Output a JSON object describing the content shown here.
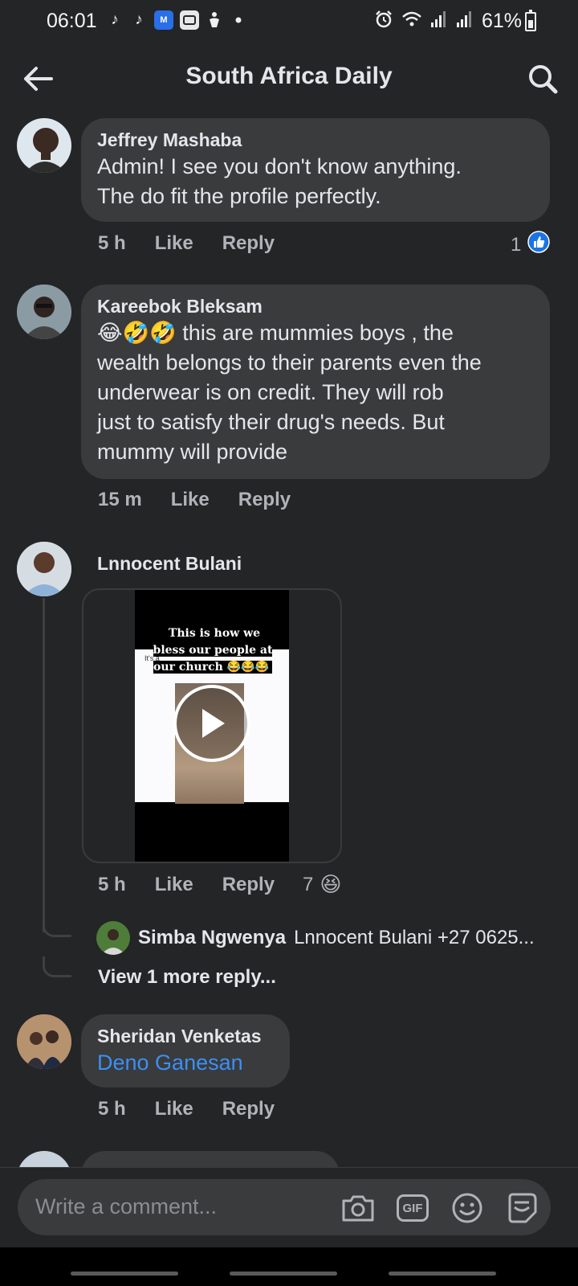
{
  "status_bar": {
    "time": "06:01",
    "battery": "61%",
    "tiktok_glyph": "♪",
    "app_badge": "M"
  },
  "header": {
    "title": "South Africa Daily"
  },
  "comments": [
    {
      "author": "Jeffrey Mashaba",
      "text_lines": [
        "Admin! I see you don't know anything.",
        "The do fit the profile perfectly."
      ],
      "time": "5 h",
      "like": "Like",
      "reply": "Reply",
      "reactions": "1"
    },
    {
      "author": "Kareebok Bleksam",
      "emoji": "😂🤣🤣",
      "text_lines": [
        " this are mummies boys , the",
        "wealth belongs to their parents even the",
        "underwear  is on credit.  They will rob",
        "just to satisfy their drug's needs.  But",
        "mummy will provide"
      ],
      "time": "15 m",
      "like": "Like",
      "reply": "Reply"
    },
    {
      "author": "Lnnocent Bulani",
      "video_caption": "This is how we bless our people at our church 😂😂😂",
      "video_side_text": "It's a",
      "time": "5 h",
      "like": "Like",
      "reply": "Reply",
      "reactions": "7",
      "reaction_emoji": "😆"
    },
    {
      "author": "Sheridan Venketas",
      "mention": "Deno Ganesan",
      "time": "5 h",
      "like": "Like",
      "reply": "Reply"
    }
  ],
  "nested_reply": {
    "author": "Simba Ngwenya",
    "text": "Lnnocent Bulani +27 0625..."
  },
  "view_more": "View 1 more reply...",
  "composer": {
    "placeholder": "Write a comment...",
    "gif_label": "GIF"
  },
  "colors": {
    "background": "#242526",
    "bubble": "#3a3b3c",
    "secondary_text": "#b0b3b8",
    "link": "#3b8ff6",
    "like_badge": "#1b74e4"
  }
}
